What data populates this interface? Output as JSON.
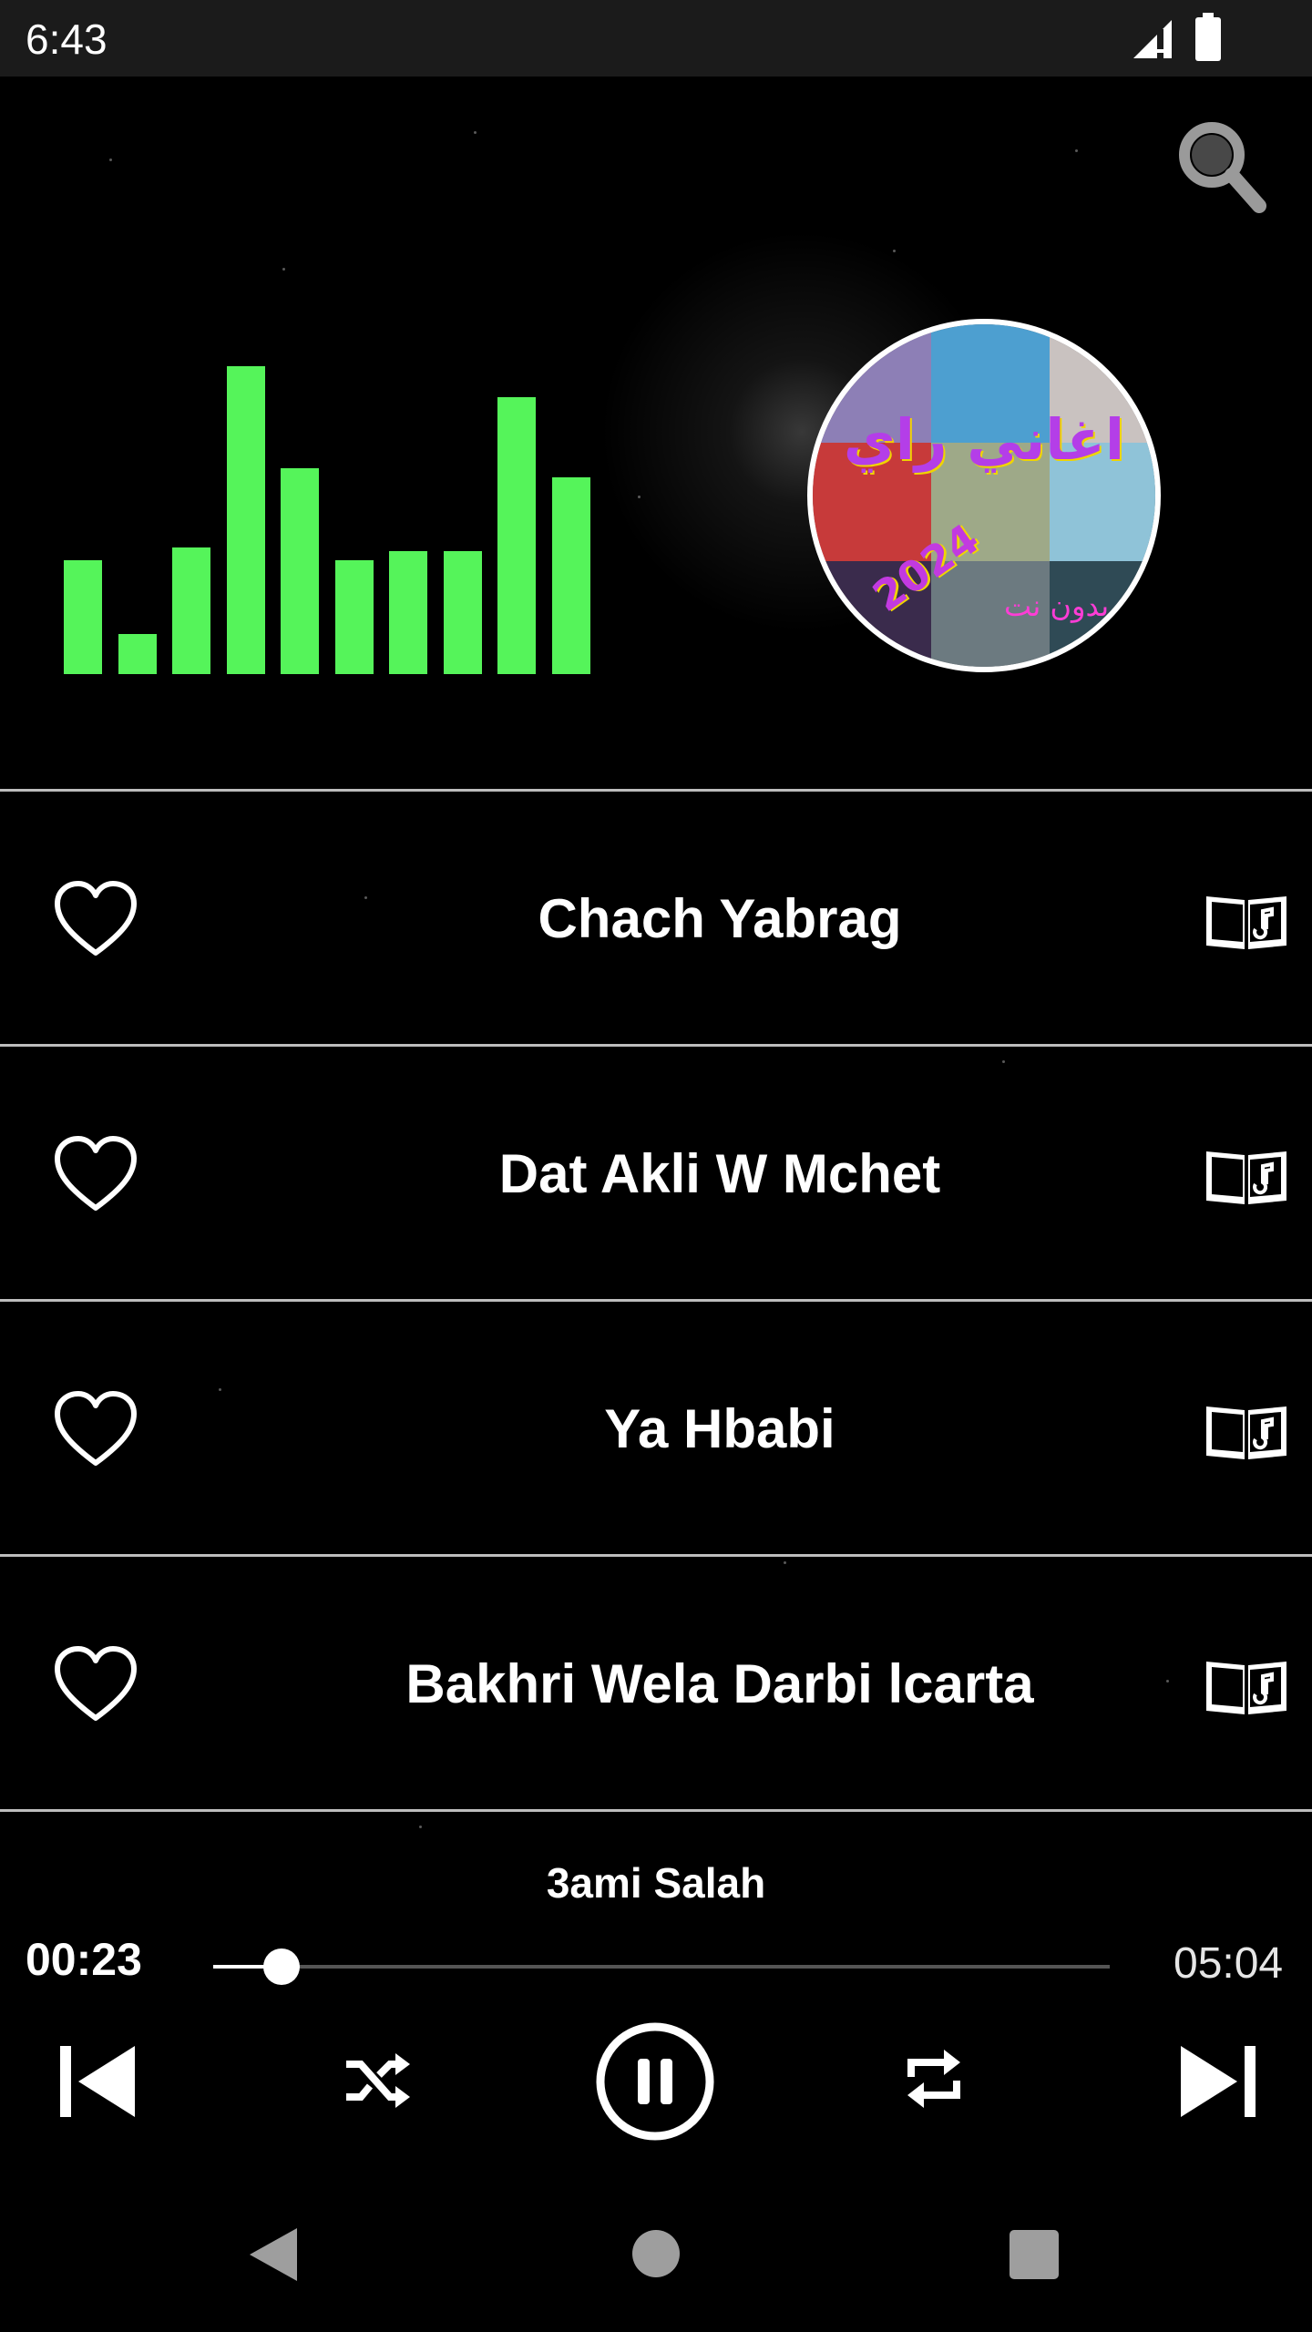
{
  "status_bar": {
    "time": "6:43"
  },
  "header": {
    "search_icon": "search-icon"
  },
  "visualizer": {
    "color": "#55f45a",
    "levels": [
      0.37,
      0.13,
      0.41,
      1.0,
      0.67,
      0.37,
      0.4,
      0.4,
      0.9,
      0.64
    ]
  },
  "album": {
    "title": "اغاني راي",
    "year": "2024",
    "subtitle": "بدون نت"
  },
  "songs": [
    {
      "title": "Chach Yabrag"
    },
    {
      "title": "Dat Akli W Mchet"
    },
    {
      "title": "Ya Hbabi"
    },
    {
      "title": "Bakhri Wela Darbi lcarta"
    }
  ],
  "player": {
    "artist": "3ami Salah",
    "current_time": "00:23",
    "total_time": "05:04",
    "progress": 0.076,
    "state": "playing"
  },
  "colors": {
    "accent": "#55f45a",
    "background": "#000000",
    "status_bar": "#1b1b1b"
  }
}
